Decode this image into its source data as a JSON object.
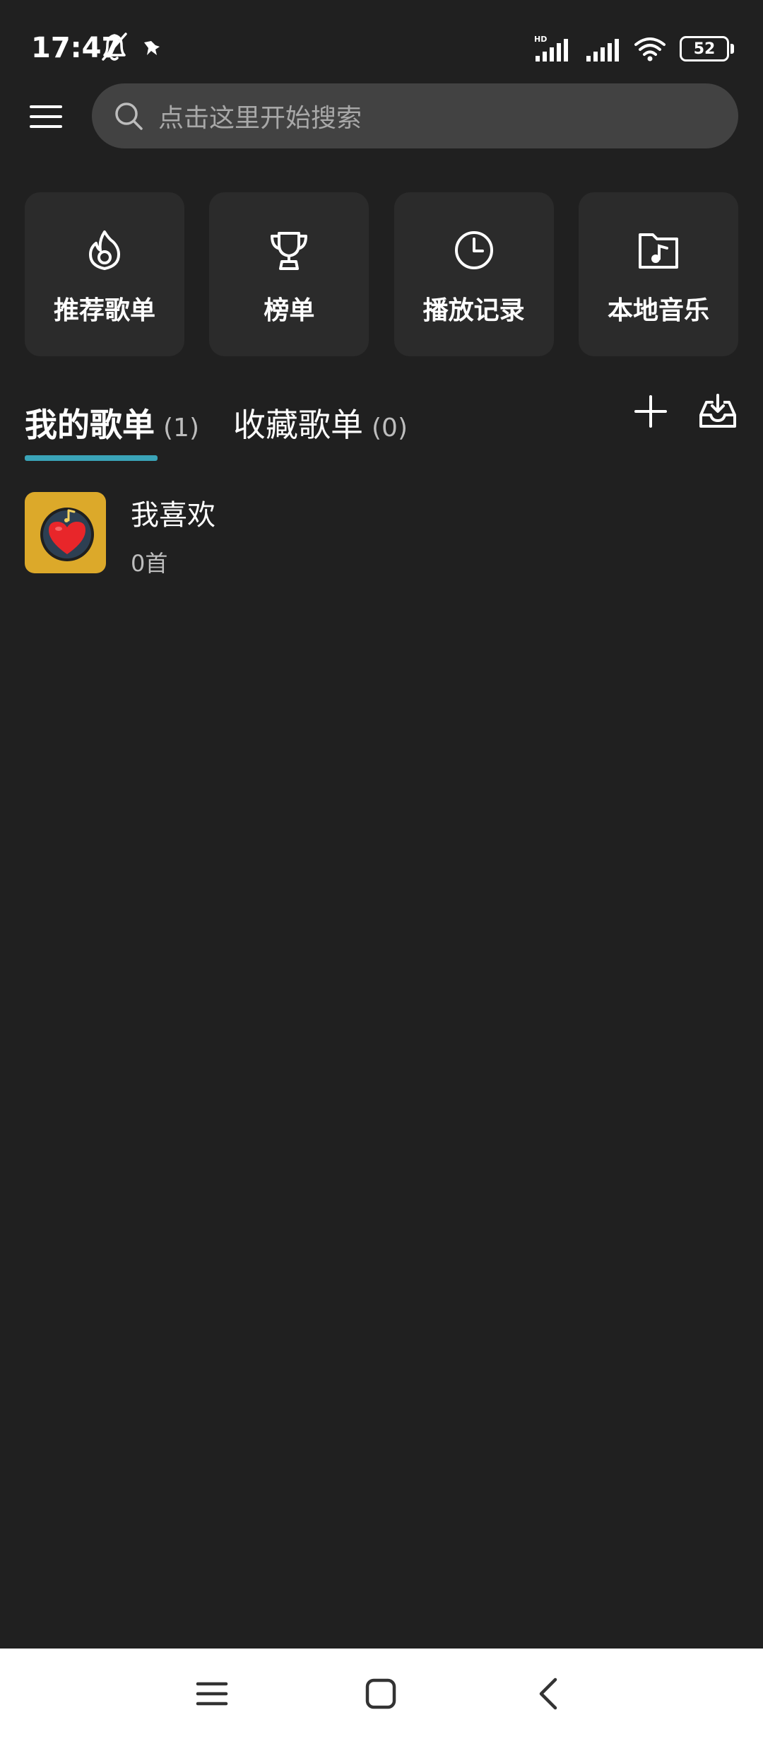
{
  "status_bar": {
    "time": "17:47",
    "battery": "52",
    "network_badge": "HD"
  },
  "header": {
    "search_placeholder": "点击这里开始搜索"
  },
  "quick_actions": [
    {
      "label": "推荐歌单",
      "icon": "flame-icon"
    },
    {
      "label": "榜单",
      "icon": "trophy-icon"
    },
    {
      "label": "播放记录",
      "icon": "clock-icon"
    },
    {
      "label": "本地音乐",
      "icon": "music-folder-icon"
    }
  ],
  "tabs": [
    {
      "label": "我的歌单",
      "count": "(1)",
      "active": true
    },
    {
      "label": "收藏歌单",
      "count": "(0)",
      "active": false
    }
  ],
  "playlists": [
    {
      "title": "我喜欢",
      "subtitle": "0首"
    }
  ],
  "colors": {
    "background": "#202020",
    "card": "#2b2b2b",
    "search_box": "#424242",
    "accent": "#3aa4b8",
    "cover": "#dca92a",
    "heart": "#e8262a"
  }
}
